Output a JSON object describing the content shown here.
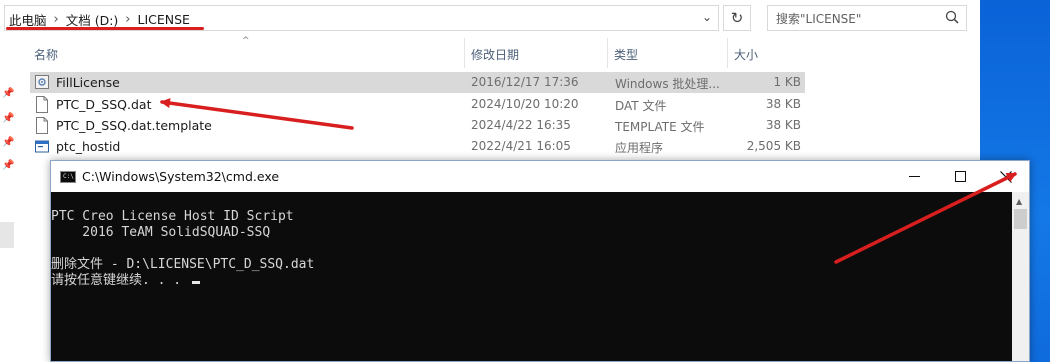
{
  "explorer": {
    "breadcrumb": [
      "此电脑",
      "文档 (D:)",
      "LICENSE"
    ],
    "search": {
      "placeholder": "搜索\"LICENSE\""
    },
    "columns": {
      "name": "名称",
      "date": "修改日期",
      "type": "类型",
      "size": "大小"
    },
    "files": [
      {
        "name": "FillLicense",
        "date": "2016/12/17 17:36",
        "type": "Windows 批处理...",
        "size": "1 KB",
        "icon": "batch-file-icon",
        "selected": true
      },
      {
        "name": "PTC_D_SSQ.dat",
        "date": "2024/10/20 10:20",
        "type": "DAT 文件",
        "size": "38 KB",
        "icon": "document-icon",
        "selected": false
      },
      {
        "name": "PTC_D_SSQ.dat.template",
        "date": "2024/4/22 16:35",
        "type": "TEMPLATE 文件",
        "size": "38 KB",
        "icon": "document-icon",
        "selected": false
      },
      {
        "name": "ptc_hostid",
        "date": "2022/4/21 16:05",
        "type": "应用程序",
        "size": "2,505 KB",
        "icon": "application-icon",
        "selected": false
      }
    ]
  },
  "cmd": {
    "title": "C:\\Windows\\System32\\cmd.exe",
    "lines": [
      "PTC Creo License Host ID Script",
      "    2016 TeAM SolidSQUAD-SSQ",
      "",
      "删除文件 - D:\\LICENSE\\PTC_D_SSQ.dat",
      "请按任意键继续. . . "
    ]
  },
  "colors": {
    "annotation_red": "#d81e1e",
    "console_bg": "#0c0c0c",
    "console_text": "#d6d6d6",
    "selected_row": "#d9d9d9",
    "desktop_blue": "#1478e6"
  }
}
